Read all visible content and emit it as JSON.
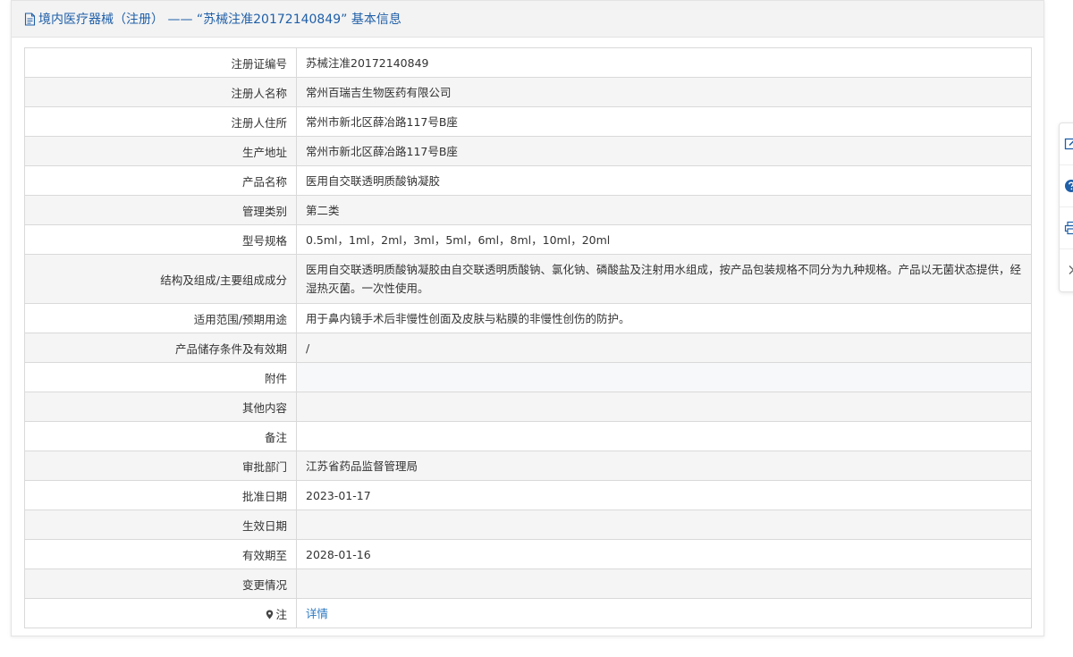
{
  "header": {
    "title": "境内医疗器械（注册） —— “苏械注准20172140849” 基本信息"
  },
  "rows": [
    {
      "label": "注册证编号",
      "value": "苏械注准20172140849"
    },
    {
      "label": "注册人名称",
      "value": "常州百瑞吉生物医药有限公司"
    },
    {
      "label": "注册人住所",
      "value": "常州市新北区薛冶路117号B座"
    },
    {
      "label": "生产地址",
      "value": "常州市新北区薛冶路117号B座"
    },
    {
      "label": "产品名称",
      "value": "医用自交联透明质酸钠凝胶"
    },
    {
      "label": "管理类别",
      "value": "第二类"
    },
    {
      "label": "型号规格",
      "value": "0.5ml，1ml，2ml，3ml，5ml，6ml，8ml，10ml，20ml"
    },
    {
      "label": "结构及组成/主要组成成分",
      "value": "医用自交联透明质酸钠凝胶由自交联透明质酸钠、氯化钠、磷酸盐及注射用水组成，按产品包装规格不同分为九种规格。产品以无菌状态提供，经湿热灭菌。一次性使用。"
    },
    {
      "label": "适用范围/预期用途",
      "value": "用于鼻内镜手术后非慢性创面及皮肤与粘膜的非慢性创伤的防护。"
    },
    {
      "label": "产品储存条件及有效期",
      "value": "/"
    },
    {
      "label": "附件",
      "value": ""
    },
    {
      "label": "其他内容",
      "value": ""
    },
    {
      "label": "备注",
      "value": ""
    },
    {
      "label": "审批部门",
      "value": "江苏省药品监督管理局"
    },
    {
      "label": "批准日期",
      "value": "2023-01-17"
    },
    {
      "label": "生效日期",
      "value": ""
    },
    {
      "label": "有效期至",
      "value": "2028-01-16"
    },
    {
      "label": "变更情况",
      "value": ""
    },
    {
      "label": "注",
      "value": "详情"
    }
  ],
  "icons": {
    "header": "document-icon",
    "note": "location-pin-icon",
    "side_tools": [
      "edit-icon",
      "help-icon",
      "print-icon",
      "chevron-right-icon"
    ]
  },
  "colors": {
    "title": "#1f5fa8",
    "link": "#2b78c2",
    "header_bg": "#f3f3f3",
    "row_alt_bg": "#f5f5f5",
    "border": "#d9d9d9"
  }
}
